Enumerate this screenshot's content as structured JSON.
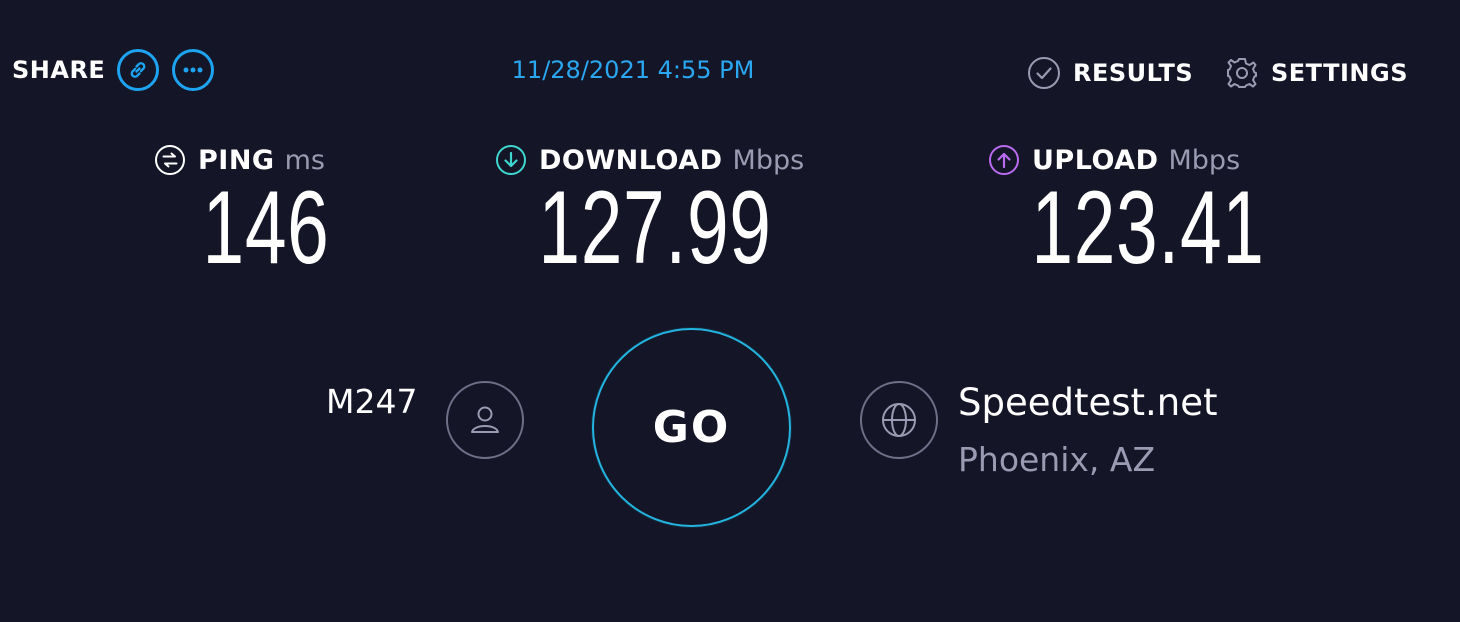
{
  "header": {
    "share_label": "SHARE",
    "timestamp": "11/28/2021 4:55 PM",
    "results_label": "RESULTS",
    "settings_label": "SETTINGS"
  },
  "metrics": {
    "ping": {
      "label": "PING",
      "unit": "ms",
      "value": "146"
    },
    "download": {
      "label": "DOWNLOAD",
      "unit": "Mbps",
      "value": "127.99"
    },
    "upload": {
      "label": "UPLOAD",
      "unit": "Mbps",
      "value": "123.41"
    }
  },
  "connection": {
    "isp": "M247",
    "go_label": "GO",
    "server_name": "Speedtest.net",
    "server_location": "Phoenix, AZ"
  },
  "colors": {
    "background": "#141526",
    "accent_blue": "#1da3f0",
    "download_cyan": "#3ed6cf",
    "upload_purple": "#b96bf0",
    "go_ring": "#23b5df",
    "muted": "#9a9bb2"
  },
  "icons": {
    "share_link": "link-icon",
    "share_more": "more-dots-icon",
    "results": "check-circle-icon",
    "settings": "gear-icon",
    "ping": "ping-icon",
    "download": "download-arrow-icon",
    "upload": "upload-arrow-icon",
    "isp": "user-icon",
    "server": "globe-icon"
  }
}
